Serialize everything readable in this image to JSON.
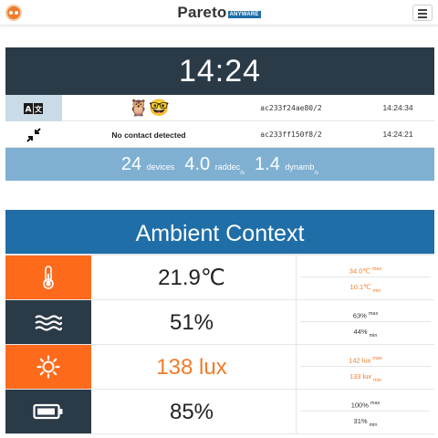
{
  "navbar": {
    "brand": "Pareto",
    "brand_tag": "ANYWARE",
    "logo_icon": "owl-logo-icon",
    "menu_icon": "hamburger-icon"
  },
  "clock": {
    "time": "14:24"
  },
  "devices": [
    {
      "icon": "translate-icon",
      "emoji": "🦉🤓",
      "status": "",
      "id": "ac233f24ae80/2",
      "time": "14:24:34"
    },
    {
      "icon": "collapse-arrows-icon",
      "emoji": "",
      "status": "No contact detected",
      "id": "ac233ff150f8/2",
      "time": "14:24:21"
    }
  ],
  "stats": {
    "devices_value": "24",
    "devices_unit": "devices",
    "raddec_value": "4.0",
    "raddec_unit": "raddec",
    "raddec_sub": "/s",
    "dynamb_value": "1.4",
    "dynamb_unit": "dynamb",
    "dynamb_sub": "/s"
  },
  "ambient": {
    "title": "Ambient Context",
    "rows": [
      {
        "icon": "thermometer-icon",
        "value": "21.9℃",
        "max": "34.0℃",
        "max_label": "max",
        "min": "10.1℃",
        "min_label": "min"
      },
      {
        "icon": "humidity-waves-icon",
        "value": "51%",
        "max": "63%",
        "max_label": "max",
        "min": "44%",
        "min_label": "min"
      },
      {
        "icon": "sun-icon",
        "value": "138 lux",
        "max": "142 lux",
        "max_label": "max",
        "min": "133 lux",
        "min_label": "min"
      },
      {
        "icon": "battery-icon",
        "value": "85%",
        "max": "100%",
        "max_label": "max",
        "min": "31%",
        "min_label": "min"
      }
    ]
  },
  "colors": {
    "navy": "#2b3a47",
    "blue": "#1f6ea8",
    "light_blue": "#7fb0d2",
    "orange": "#fe6a1b"
  }
}
